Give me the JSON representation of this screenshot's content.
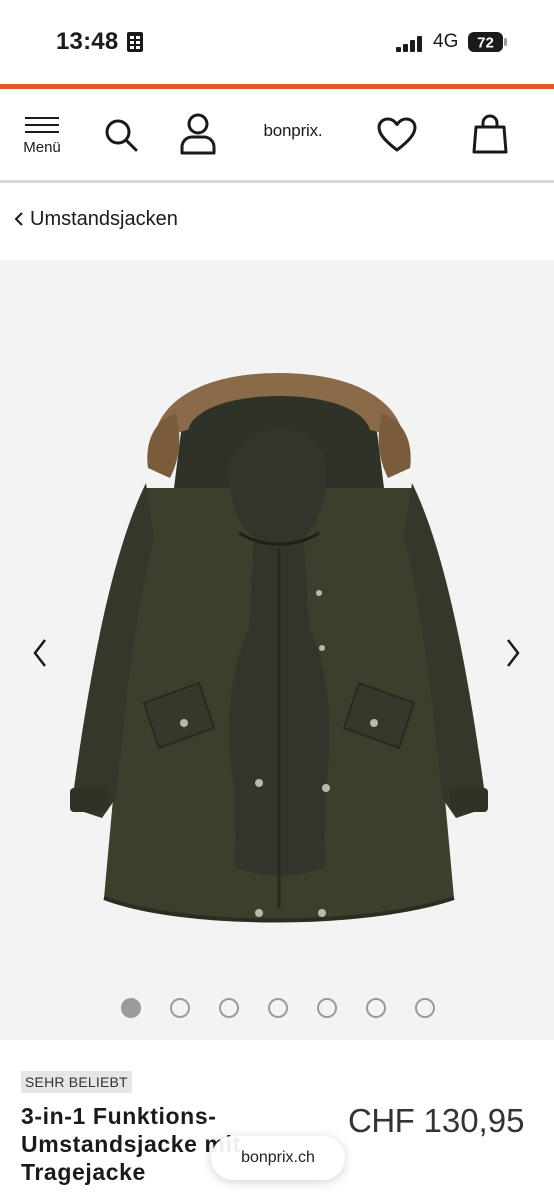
{
  "status_bar": {
    "time": "13:48",
    "network": "4G",
    "battery": "72"
  },
  "header": {
    "menu_label": "Menü",
    "logo_text": "bonprix."
  },
  "breadcrumb": {
    "label": "Umstandsjacken"
  },
  "gallery": {
    "image_count": 7,
    "active_index": 0
  },
  "product": {
    "badge": "SEHR BELIEBT",
    "title_lines": [
      "3-in-1 Funktions-",
      "Umstandsjacke mit",
      "Tragejacke"
    ],
    "price_currency": "CHF",
    "price_value": "130,95"
  },
  "browser": {
    "domain": "bonprix.ch"
  },
  "colors": {
    "accent": "#e4572e",
    "jacket": "#3c3f2b",
    "fur": "#8a6a48"
  }
}
